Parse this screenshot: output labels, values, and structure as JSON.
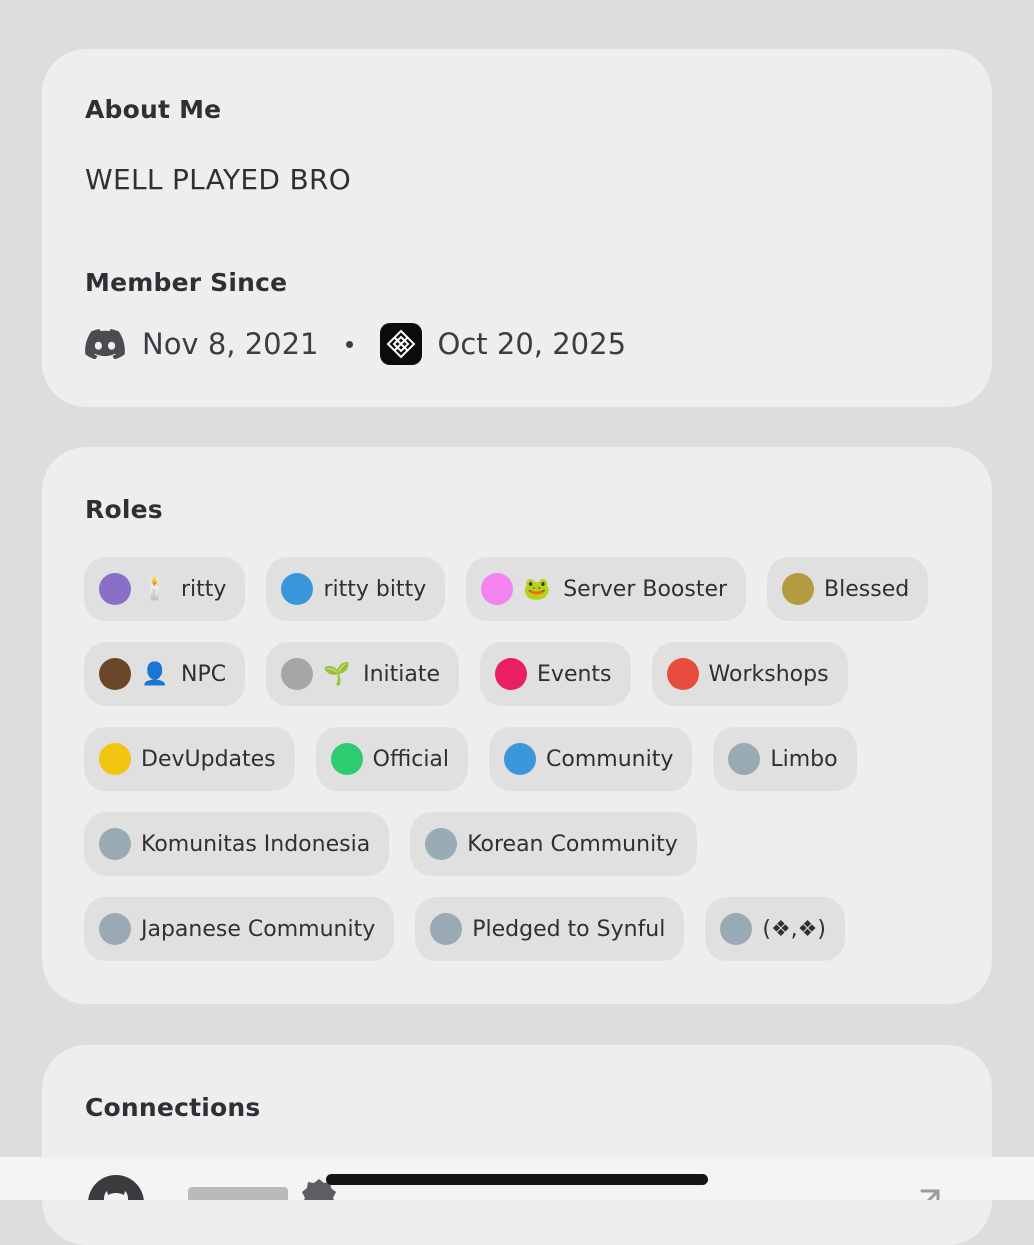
{
  "about": {
    "title": "About Me",
    "text": "WELL PLAYED BRO"
  },
  "member_since": {
    "title": "Member Since",
    "discord_date": "Nov 8, 2021",
    "server_date": "Oct 20, 2025"
  },
  "roles": {
    "title": "Roles",
    "items": [
      {
        "label": "ritty",
        "color": "#8a6fc9",
        "emoji": "🕯️"
      },
      {
        "label": "ritty bitty",
        "color": "#3a97dc",
        "emoji": ""
      },
      {
        "label": "Server Booster",
        "color": "#f383f0",
        "emoji": "🐸"
      },
      {
        "label": "Blessed",
        "color": "#b59b3f",
        "emoji": ""
      },
      {
        "label": "NPC",
        "color": "#6b4727",
        "emoji": "👤"
      },
      {
        "label": "Initiate",
        "color": "#a6a6a6",
        "emoji": "🌱"
      },
      {
        "label": "Events",
        "color": "#e91e63",
        "emoji": ""
      },
      {
        "label": "Workshops",
        "color": "#e74c3c",
        "emoji": ""
      },
      {
        "label": "DevUpdates",
        "color": "#f1c40f",
        "emoji": ""
      },
      {
        "label": "Official",
        "color": "#2ecc71",
        "emoji": ""
      },
      {
        "label": "Community",
        "color": "#3a97dc",
        "emoji": ""
      },
      {
        "label": "Limbo",
        "color": "#99aab5",
        "emoji": ""
      },
      {
        "label": "Komunitas Indonesia",
        "color": "#99aab5",
        "emoji": ""
      },
      {
        "label": "Korean Community",
        "color": "#99aab5",
        "emoji": ""
      },
      {
        "label": "Japanese Community",
        "color": "#99aab5",
        "emoji": ""
      },
      {
        "label": "Pledged to Synful",
        "color": "#99aab5",
        "emoji": ""
      },
      {
        "label": "(❖,❖)",
        "color": "#99aab5",
        "emoji": ""
      }
    ]
  },
  "connections": {
    "title": "Connections"
  }
}
